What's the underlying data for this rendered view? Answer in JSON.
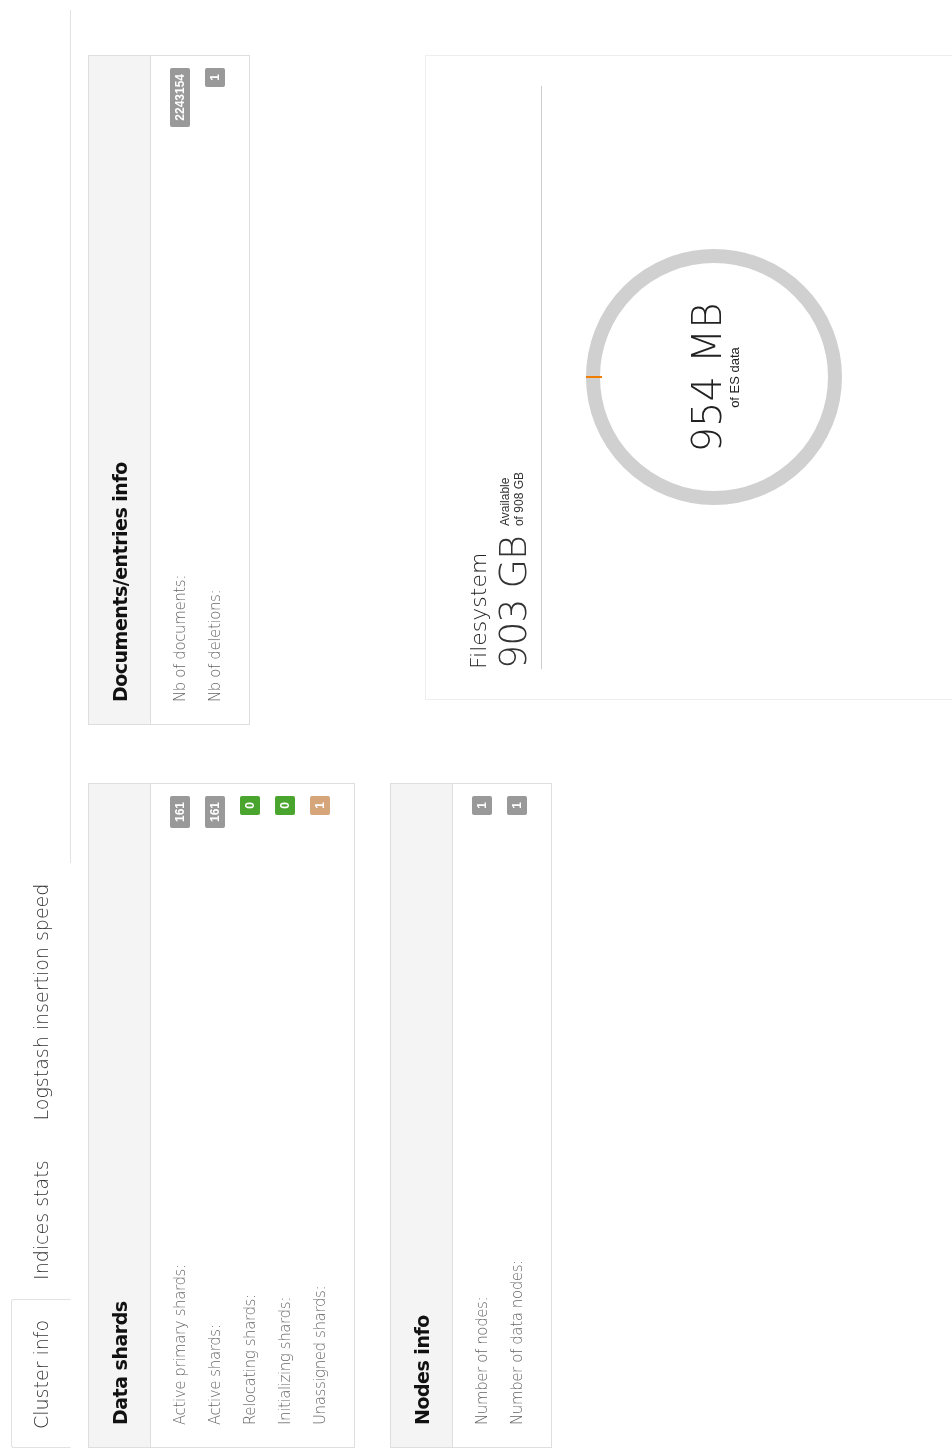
{
  "tabs": [
    {
      "label": "Cluster info",
      "selected": true
    },
    {
      "label": "Indices stats",
      "selected": false
    },
    {
      "label": "Logstash insertion speed",
      "selected": false
    }
  ],
  "panels": [
    {
      "title": "Data shards",
      "rows": [
        {
          "label": "Active primary shards:",
          "value": "161",
          "color": "#999999"
        },
        {
          "label": "Active shards:",
          "value": "161",
          "color": "#999999"
        },
        {
          "label": "Relocating shards:",
          "value": "0",
          "color": "#4aa52e"
        },
        {
          "label": "Initializing shards:",
          "value": "0",
          "color": "#4aa52e"
        },
        {
          "label": "Unassigned shards:",
          "value": "1",
          "color": "#d6a57a"
        }
      ]
    },
    {
      "title": "Nodes info",
      "rows": [
        {
          "label": "Number of nodes:",
          "value": "1",
          "color": "#999999"
        },
        {
          "label": "Number of data nodes:",
          "value": "1",
          "color": "#999999"
        }
      ]
    },
    {
      "title": "Documents/entries info",
      "rows": [
        {
          "label": "Nb of documents:",
          "value": "2243154",
          "color": "#999999"
        },
        {
          "label": "Nb of deletions:",
          "value": "1",
          "color": "#999999"
        }
      ]
    }
  ],
  "filesystem": {
    "title": "Filesystem",
    "available": "903 GB",
    "available_label": "Available",
    "total": "of 908 GB",
    "es_data": "954 MB",
    "es_data_label": "of ES data"
  }
}
